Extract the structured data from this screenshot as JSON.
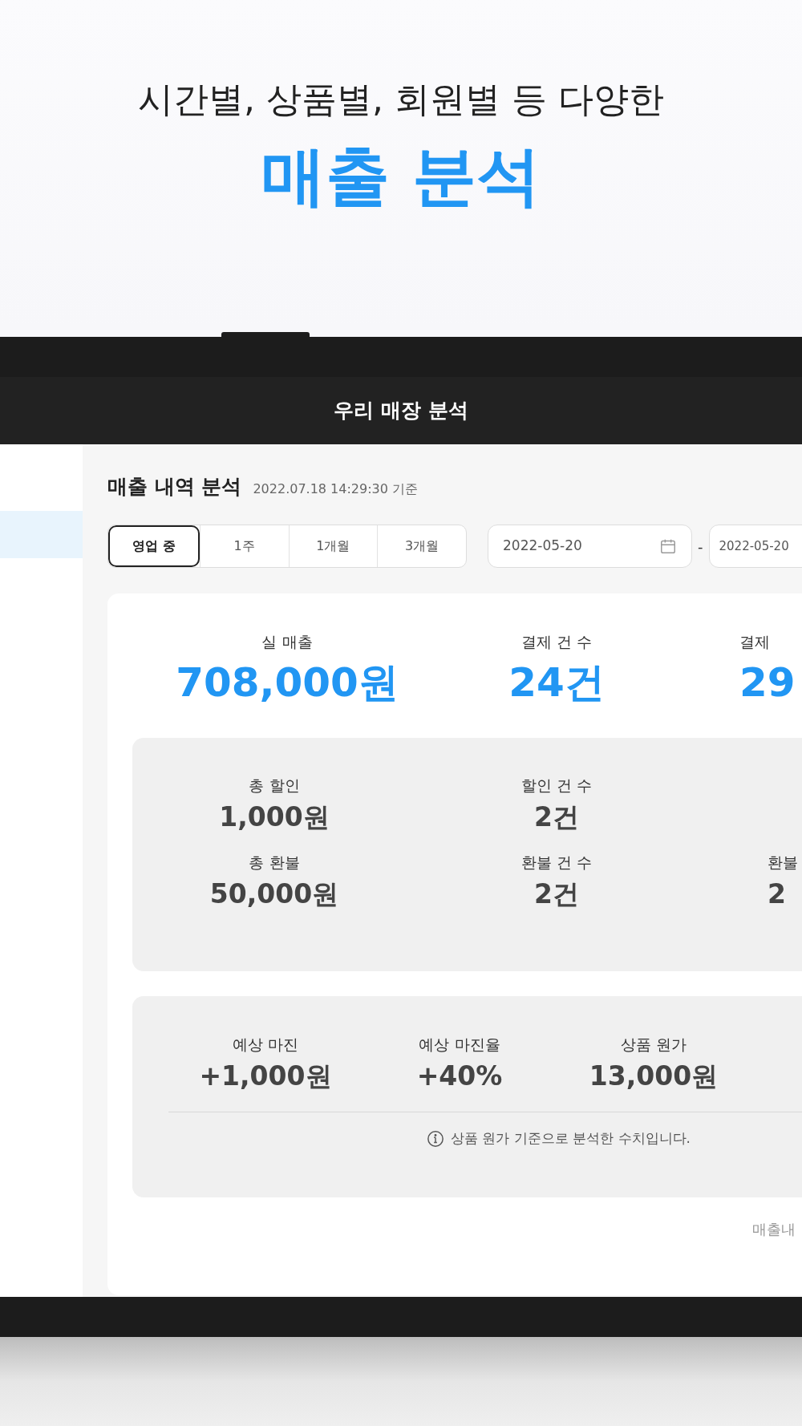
{
  "headline": {
    "subtitle": "시간별, 상품별, 회원별 등 다양한",
    "title": "매출 분석"
  },
  "app": {
    "title": "우리 매장 분석"
  },
  "report": {
    "heading": "매출 내역 분석",
    "timestamp": "2022.07.18 14:29:30 기준",
    "periods": [
      {
        "label": "영업 중",
        "selected": true
      },
      {
        "label": "1주",
        "selected": false
      },
      {
        "label": "1개월",
        "selected": false
      },
      {
        "label": "3개월",
        "selected": false
      }
    ],
    "start_date": "2022-05-20",
    "separator": "-",
    "end_date": "2022-05-20",
    "summary": [
      {
        "label": "실 매출",
        "value": "708,000원"
      },
      {
        "label": "결제 건 수",
        "value": "24건"
      },
      {
        "label": "결제",
        "value": "29"
      }
    ],
    "adjustments": [
      [
        {
          "label": "총 할인",
          "value": "1,000원"
        },
        {
          "label": "할인 건 수",
          "value": "2건"
        }
      ],
      [
        {
          "label": "총 환불",
          "value": "50,000원"
        },
        {
          "label": "환불 건 수",
          "value": "2건"
        },
        {
          "label": "환불",
          "value": "2"
        }
      ]
    ],
    "margins": [
      {
        "label": "예상 마진",
        "value": "+1,000원"
      },
      {
        "label": "예상 마진율",
        "value": "+40%"
      },
      {
        "label": "상품 원가",
        "value": "13,000원"
      }
    ],
    "note": "상품 원가 기준으로 분석한 수치입니다.",
    "link": "매출내"
  }
}
